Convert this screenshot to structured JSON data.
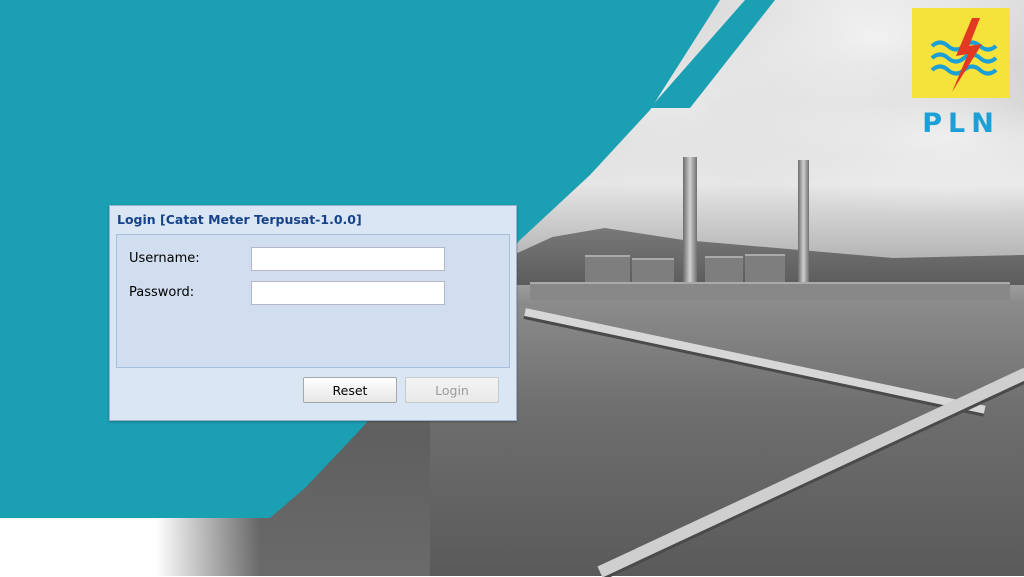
{
  "brand": {
    "logo_text": "PLN",
    "primary_color": "#1a9fb3",
    "logo_yellow": "#f5e23a",
    "logo_blue": "#1a9fd6"
  },
  "dialog": {
    "title": "Login [Catat Meter Terpusat-1.0.0]",
    "username_label": "Username:",
    "username_value": "",
    "password_label": "Password:",
    "password_value": "",
    "reset_label": "Reset",
    "login_label": "Login",
    "login_enabled": false
  }
}
